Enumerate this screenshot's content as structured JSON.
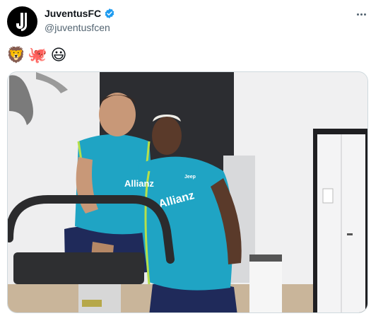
{
  "tweet": {
    "author_name": "JuventusFC",
    "handle": "@juventusfcen",
    "verified": true,
    "avatar_icon": "juventus-logo-icon",
    "emojis": [
      "🦁",
      "🐙",
      "😃"
    ],
    "more_icon": "more-options-icon"
  },
  "photo": {
    "shirt_text_left": "Allianz",
    "shirt_text_right": "Allianz",
    "sponsor_small": "Jeep",
    "colors": {
      "shirt": "#1fa4c4",
      "shorts": "#1f2a5a",
      "wall": "#f2f2f2",
      "dark_panel": "#2c2d31",
      "lime_trim": "#b6e04a"
    }
  },
  "colors": {
    "text": "#0f1419",
    "muted": "#536471",
    "verified": "#1d9bf0",
    "border": "#cfd9de"
  }
}
